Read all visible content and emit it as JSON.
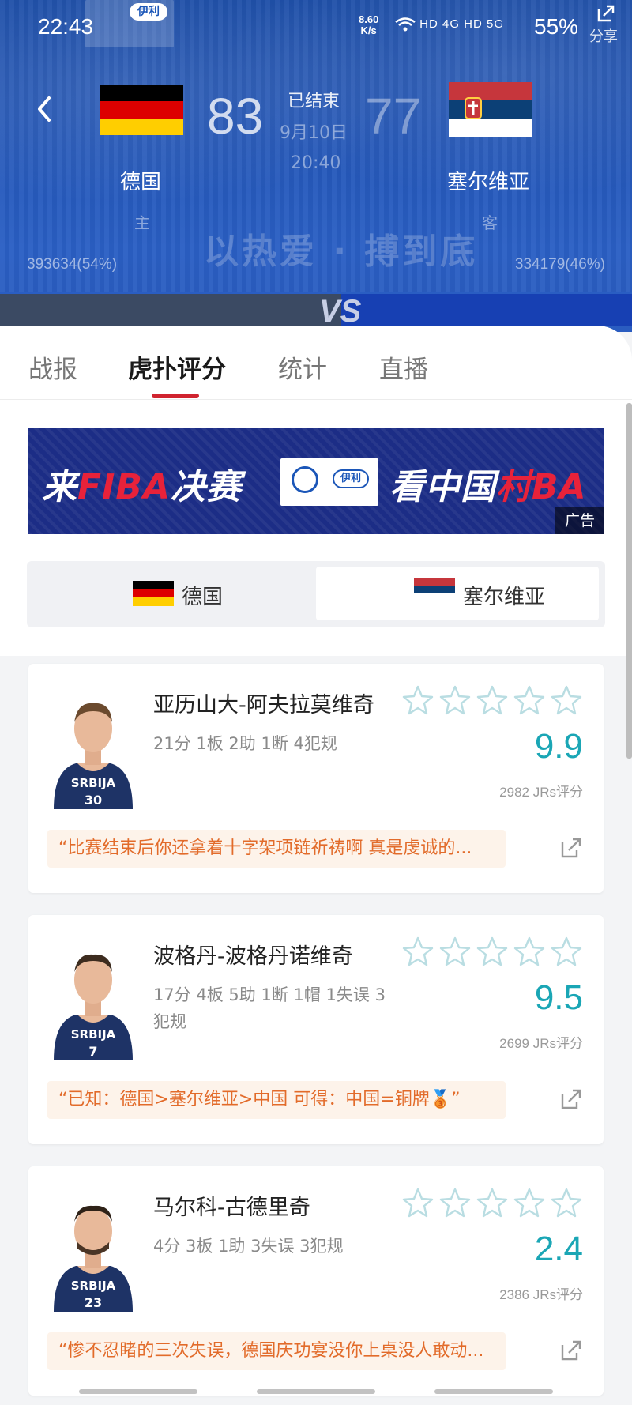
{
  "status_bar": {
    "time": "22:43",
    "speed_value": "8.60",
    "speed_unit": "K/s",
    "network": "HD 4G HD 5G",
    "battery": "55%"
  },
  "header": {
    "share_label": "分享",
    "status": "已结束",
    "date": "9月10日",
    "time": "20:40",
    "home": {
      "name": "德国",
      "score": "83",
      "role": "主",
      "support": "393634(54%)",
      "support_pct": 54
    },
    "away": {
      "name": "塞尔维亚",
      "score": "77",
      "role": "客",
      "support": "334179(46%)",
      "support_pct": 46
    },
    "slogan": "以热爱 · 搏到底",
    "vs_label": "VS",
    "logo_brand": "伊利"
  },
  "tabs": [
    {
      "label": "战报"
    },
    {
      "label": "虎扑评分"
    },
    {
      "label": "统计"
    },
    {
      "label": "直播"
    }
  ],
  "active_tab": "虎扑评分",
  "ad": {
    "left_text_white": "来",
    "left_text_red": "FIBA",
    "left_text_white2": "决赛",
    "right_text_white": "看中国",
    "right_text_red": "村BA",
    "logo_brand": "伊利",
    "tag": "广告"
  },
  "team_switch": {
    "home": "德国",
    "away": "塞尔维亚",
    "selected": "塞尔维亚"
  },
  "players": [
    {
      "name": "亚历山大-阿夫拉莫维奇",
      "stats": "21分 1板 2助 1断 4犯规",
      "rating": "9.9",
      "votes": "2982 JRs评分",
      "comment": "“比赛结束后你还拿着十字架项链祈祷啊 真是虔诚的...",
      "jersey": "30",
      "team_text": "SRBIJA"
    },
    {
      "name": "波格丹-波格丹诺维奇",
      "stats": "17分 4板 5助 1断 1帽 1失误 3犯规",
      "rating": "9.5",
      "votes": "2699 JRs评分",
      "comment": "“已知：德国>塞尔维亚>中国 可得：中国=铜牌🥉”",
      "jersey": "7",
      "team_text": "SRBIJA"
    },
    {
      "name": "马尔科-古德里奇",
      "stats": "4分 3板 1助 3失误 3犯规",
      "rating": "2.4",
      "votes": "2386 JRs评分",
      "comment": "“惨不忍睹的三次失误，德国庆功宴没你上桌没人敢动...",
      "jersey": "23",
      "team_text": "SRBIJA"
    }
  ],
  "colors": {
    "header_blue": "#2457b8",
    "accent_red": "#d0232f",
    "rating_teal": "#1aa6b5",
    "comment_orange": "#e26b2a",
    "star_outline": "#b9dde2"
  }
}
